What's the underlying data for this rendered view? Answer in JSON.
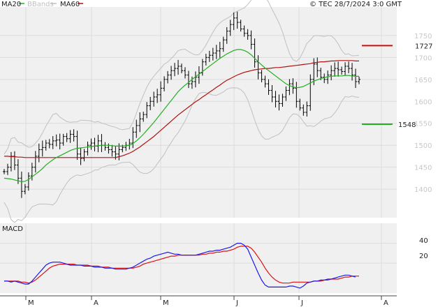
{
  "header": {
    "legend_ma20": "MA20",
    "legend_bbands": "BBands",
    "legend_ma60": "MA60",
    "copyright": "© TEC 28/7/2024 3:0 GMT"
  },
  "colors": {
    "ma20": "#22b022",
    "ma60": "#b01010",
    "bbands": "#c0c0c0",
    "price": "#000000",
    "panel_bg": "#f0f0f0",
    "macd": "#1a1aee",
    "signal": "#dd1111",
    "resistance": "#cc1010",
    "support": "#20b020"
  },
  "price_panel": {
    "y_ticks": [
      "1750",
      "1700",
      "1650",
      "1600",
      "1550",
      "1500",
      "1450",
      "1400"
    ],
    "resistance": {
      "value": 1727,
      "label": "1727"
    },
    "support": {
      "value": 1548,
      "label": "1548"
    }
  },
  "macd_panel": {
    "title": "MACD",
    "y_ticks": [
      "40",
      "20"
    ]
  },
  "x_months": [
    "M",
    "A",
    "M",
    "J",
    "J",
    "A"
  ],
  "chart_data": {
    "type": "ohlc",
    "y_range": [
      1335,
      1815
    ],
    "macd_range": [
      -10,
      60
    ],
    "close": [
      1440,
      1450,
      1475,
      1455,
      1425,
      1395,
      1405,
      1430,
      1450,
      1475,
      1490,
      1495,
      1505,
      1502,
      1510,
      1512,
      1505,
      1520,
      1515,
      1525,
      1520,
      1480,
      1470,
      1485,
      1500,
      1505,
      1498,
      1510,
      1500,
      1495,
      1490,
      1485,
      1480,
      1490,
      1495,
      1500,
      1505,
      1530,
      1545,
      1560,
      1570,
      1590,
      1600,
      1610,
      1615,
      1630,
      1650,
      1660,
      1670,
      1675,
      1680,
      1670,
      1660,
      1640,
      1645,
      1655,
      1665,
      1690,
      1700,
      1705,
      1710,
      1715,
      1720,
      1740,
      1760,
      1775,
      1790,
      1780,
      1765,
      1755,
      1750,
      1730,
      1690,
      1665,
      1650,
      1640,
      1625,
      1610,
      1600,
      1595,
      1610,
      1625,
      1640,
      1630,
      1600,
      1585,
      1575,
      1590,
      1650,
      1685,
      1670,
      1655,
      1650,
      1660,
      1670,
      1675,
      1672,
      1668,
      1680,
      1675,
      1660,
      1645,
      1650
    ],
    "ma20": [
      1425,
      1424,
      1423,
      1421,
      1419,
      1417,
      1418,
      1422,
      1428,
      1434,
      1440,
      1447,
      1455,
      1461,
      1467,
      1472,
      1476,
      1480,
      1484,
      1488,
      1491,
      1493,
      1494,
      1495,
      1496,
      1497,
      1498,
      1499,
      1500,
      1500,
      1500,
      1499,
      1498,
      1498,
      1498,
      1499,
      1500,
      1504,
      1510,
      1517,
      1525,
      1534,
      1543,
      1552,
      1562,
      1572,
      1582,
      1592,
      1602,
      1612,
      1622,
      1630,
      1637,
      1643,
      1650,
      1656,
      1662,
      1668,
      1674,
      1680,
      1686,
      1692,
      1698,
      1703,
      1708,
      1712,
      1716,
      1718,
      1718,
      1716,
      1712,
      1706,
      1698,
      1690,
      1683,
      1676,
      1670,
      1664,
      1658,
      1652,
      1646,
      1640,
      1636,
      1633,
      1631,
      1632,
      1634,
      1638,
      1642,
      1646,
      1649,
      1652,
      1654,
      1656,
      1657,
      1658,
      1658,
      1658,
      1659,
      1659,
      1658,
      1657,
      1657
    ],
    "ma60": [
      1475,
      1475,
      1474,
      1474,
      1473,
      1473,
      1472,
      1472,
      1472,
      1472,
      1472,
      1472,
      1472,
      1472,
      1472,
      1472,
      1472,
      1472,
      1472,
      1472,
      1472,
      1472,
      1472,
      1472,
      1472,
      1472,
      1472,
      1472,
      1472,
      1472,
      1472,
      1472,
      1472,
      1474,
      1476,
      1479,
      1482,
      1486,
      1491,
      1496,
      1502,
      1508,
      1514,
      1520,
      1527,
      1534,
      1541,
      1548,
      1555,
      1562,
      1569,
      1575,
      1581,
      1587,
      1593,
      1599,
      1604,
      1610,
      1615,
      1621,
      1626,
      1632,
      1637,
      1643,
      1648,
      1652,
      1656,
      1660,
      1663,
      1666,
      1668,
      1670,
      1672,
      1673,
      1674,
      1675,
      1675,
      1676,
      1677,
      1677,
      1678,
      1679,
      1680,
      1681,
      1682,
      1683,
      1684,
      1685,
      1686,
      1688,
      1689,
      1690,
      1690,
      1691,
      1692,
      1692,
      1693,
      1693,
      1693,
      1693,
      1693,
      1692,
      1692
    ],
    "macd": [
      2,
      2,
      1,
      2,
      1,
      0,
      -1,
      -1,
      2,
      6,
      10,
      14,
      18,
      20,
      21,
      21,
      21,
      20,
      19,
      18,
      18,
      18,
      18,
      17,
      17,
      17,
      16,
      16,
      16,
      15,
      15,
      15,
      14,
      14,
      14,
      14,
      15,
      16,
      18,
      20,
      22,
      24,
      25,
      27,
      28,
      29,
      30,
      31,
      30,
      29,
      29,
      28,
      28,
      28,
      28,
      28,
      29,
      30,
      31,
      32,
      32,
      33,
      33,
      34,
      35,
      36,
      38,
      40,
      40,
      38,
      34,
      26,
      18,
      10,
      3,
      -2,
      -4,
      -4,
      -4,
      -4,
      -4,
      -4,
      -3,
      -3,
      -4,
      -5,
      -3,
      0,
      1,
      2,
      2,
      3,
      3,
      4,
      4,
      5,
      6,
      7,
      8,
      8,
      7,
      6
    ],
    "signal": [
      2,
      2,
      2,
      2,
      2,
      1,
      1,
      0,
      1,
      3,
      6,
      9,
      12,
      15,
      17,
      18,
      19,
      19,
      19,
      19,
      19,
      18,
      18,
      18,
      18,
      17,
      17,
      17,
      16,
      16,
      16,
      15,
      15,
      15,
      15,
      15,
      15,
      15,
      16,
      17,
      19,
      20,
      21,
      22,
      23,
      24,
      25,
      26,
      27,
      27,
      28,
      28,
      28,
      28,
      28,
      28,
      28,
      29,
      29,
      30,
      30,
      31,
      31,
      32,
      32,
      33,
      34,
      36,
      37,
      37,
      37,
      35,
      31,
      26,
      21,
      15,
      10,
      6,
      3,
      1,
      0,
      0,
      0,
      1,
      1,
      1,
      1,
      1,
      1,
      2,
      2,
      2,
      3,
      3,
      4,
      4,
      4,
      5,
      6,
      6,
      7,
      7,
      7
    ]
  }
}
